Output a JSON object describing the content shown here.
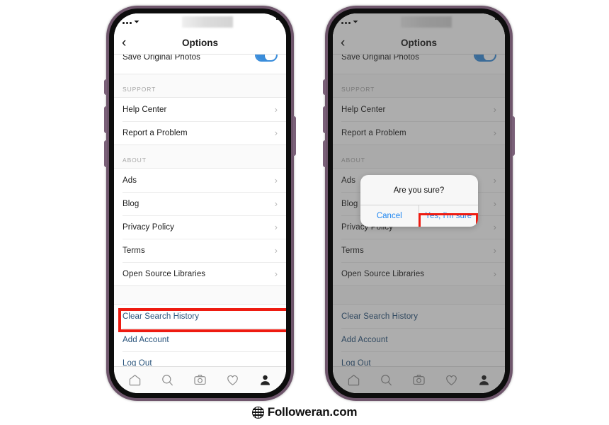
{
  "watermark": {
    "text": "Followeran.com",
    "icon": "globe-icon"
  },
  "phones": [
    {
      "id": "phone-before",
      "frame_color": "#6f566c",
      "statusbar": {
        "signal": "signal-dots-icon",
        "wifi": "wifi-icon"
      },
      "navbar": {
        "back": "chevron-left-icon",
        "title": "Options"
      },
      "toggle_row": {
        "label": "Save Original Photos",
        "state": "on",
        "color": "#3a8ddb"
      },
      "sections": [
        {
          "header": "SUPPORT",
          "items": [
            {
              "label": "Help Center",
              "chevron": "chevron-right-icon"
            },
            {
              "label": "Report a Problem",
              "chevron": "chevron-right-icon"
            }
          ]
        },
        {
          "header": "ABOUT",
          "items": [
            {
              "label": "Ads",
              "chevron": "chevron-right-icon"
            },
            {
              "label": "Blog",
              "chevron": "chevron-right-icon"
            },
            {
              "label": "Privacy Policy",
              "chevron": "chevron-right-icon"
            },
            {
              "label": "Terms",
              "chevron": "chevron-right-icon"
            },
            {
              "label": "Open Source Libraries",
              "chevron": "chevron-right-icon"
            }
          ]
        }
      ],
      "account_actions": [
        {
          "label": "Clear Search History",
          "highlighted": true
        },
        {
          "label": "Add Account",
          "highlighted": false
        },
        {
          "label": "Log Out",
          "highlighted": false
        }
      ],
      "tabbar": [
        {
          "icon": "home-icon",
          "active": false
        },
        {
          "icon": "search-icon",
          "active": false
        },
        {
          "icon": "camera-icon",
          "active": false
        },
        {
          "icon": "heart-icon",
          "active": false
        },
        {
          "icon": "profile-icon",
          "active": true
        }
      ],
      "annotation": {
        "color": "#ee1b11",
        "target": "Clear Search History"
      }
    },
    {
      "id": "phone-after",
      "frame_color": "#6f566c",
      "dimmed": true,
      "statusbar": {
        "signal": "signal-dots-icon",
        "wifi": "wifi-icon"
      },
      "navbar": {
        "back": "chevron-left-icon",
        "title": "Options"
      },
      "toggle_row": {
        "label": "Save Original Photos",
        "state": "on",
        "color": "#3a8ddb"
      },
      "sections": [
        {
          "header": "SUPPORT",
          "items": [
            {
              "label": "Help Center",
              "chevron": "chevron-right-icon"
            },
            {
              "label": "Report a Problem",
              "chevron": "chevron-right-icon"
            }
          ]
        },
        {
          "header": "ABOUT",
          "items": [
            {
              "label": "Ads",
              "chevron": "chevron-right-icon"
            },
            {
              "label": "Blog",
              "chevron": "chevron-right-icon"
            },
            {
              "label": "Privacy Policy",
              "chevron": "chevron-right-icon"
            },
            {
              "label": "Terms",
              "chevron": "chevron-right-icon"
            },
            {
              "label": "Open Source Libraries",
              "chevron": "chevron-right-icon"
            }
          ]
        }
      ],
      "account_actions": [
        {
          "label": "Clear Search History",
          "highlighted": false
        },
        {
          "label": "Add Account",
          "highlighted": false
        },
        {
          "label": "Log Out",
          "highlighted": false
        }
      ],
      "tabbar": [
        {
          "icon": "home-icon",
          "active": false
        },
        {
          "icon": "search-icon",
          "active": false
        },
        {
          "icon": "camera-icon",
          "active": false
        },
        {
          "icon": "heart-icon",
          "active": false
        },
        {
          "icon": "profile-icon",
          "active": true
        }
      ],
      "dialog": {
        "title": "Are you sure?",
        "buttons": [
          {
            "label": "Cancel",
            "highlighted": false,
            "color": "#1f86f0"
          },
          {
            "label": "Yes, I'm sure",
            "highlighted": true,
            "color": "#1f86f0"
          }
        ],
        "annotation_color": "#ee1b11"
      }
    }
  ]
}
